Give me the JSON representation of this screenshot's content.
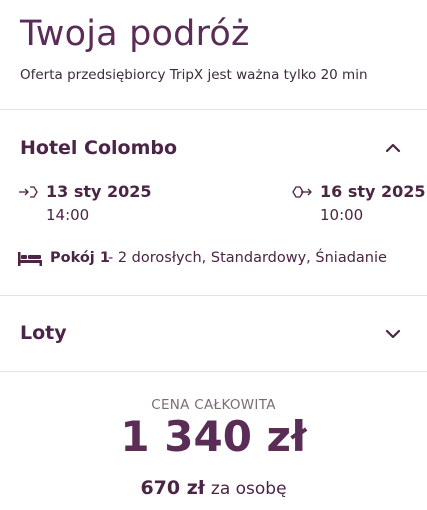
{
  "header": {
    "title": "Twoja podróż",
    "subtitle": "Oferta przedsiębiorcy TripX jest ważna tylko 20 min"
  },
  "hotel": {
    "name": "Hotel Colombo",
    "expanded": true,
    "checkin": {
      "date": "13 sty 2025",
      "time": "14:00",
      "icon": "check-in-icon"
    },
    "checkout": {
      "date": "16 sty 2025",
      "time": "10:00",
      "icon": "check-out-icon"
    },
    "room": {
      "icon": "bed-icon",
      "name": "Pokój 1",
      "details": "- 2 dorosłych, Standardowy, Śniadanie"
    }
  },
  "flights": {
    "title": "Loty",
    "expanded": false
  },
  "price": {
    "label": "CENA CAŁKOWITA",
    "total": "1 340 zł",
    "per_person_amount": "670 zł",
    "per_person_unit": "za osobę"
  },
  "colors": {
    "accent": "#5a2d57",
    "text": "#4a2545",
    "muted": "#7d6b78",
    "divider": "#e6e1e5"
  }
}
